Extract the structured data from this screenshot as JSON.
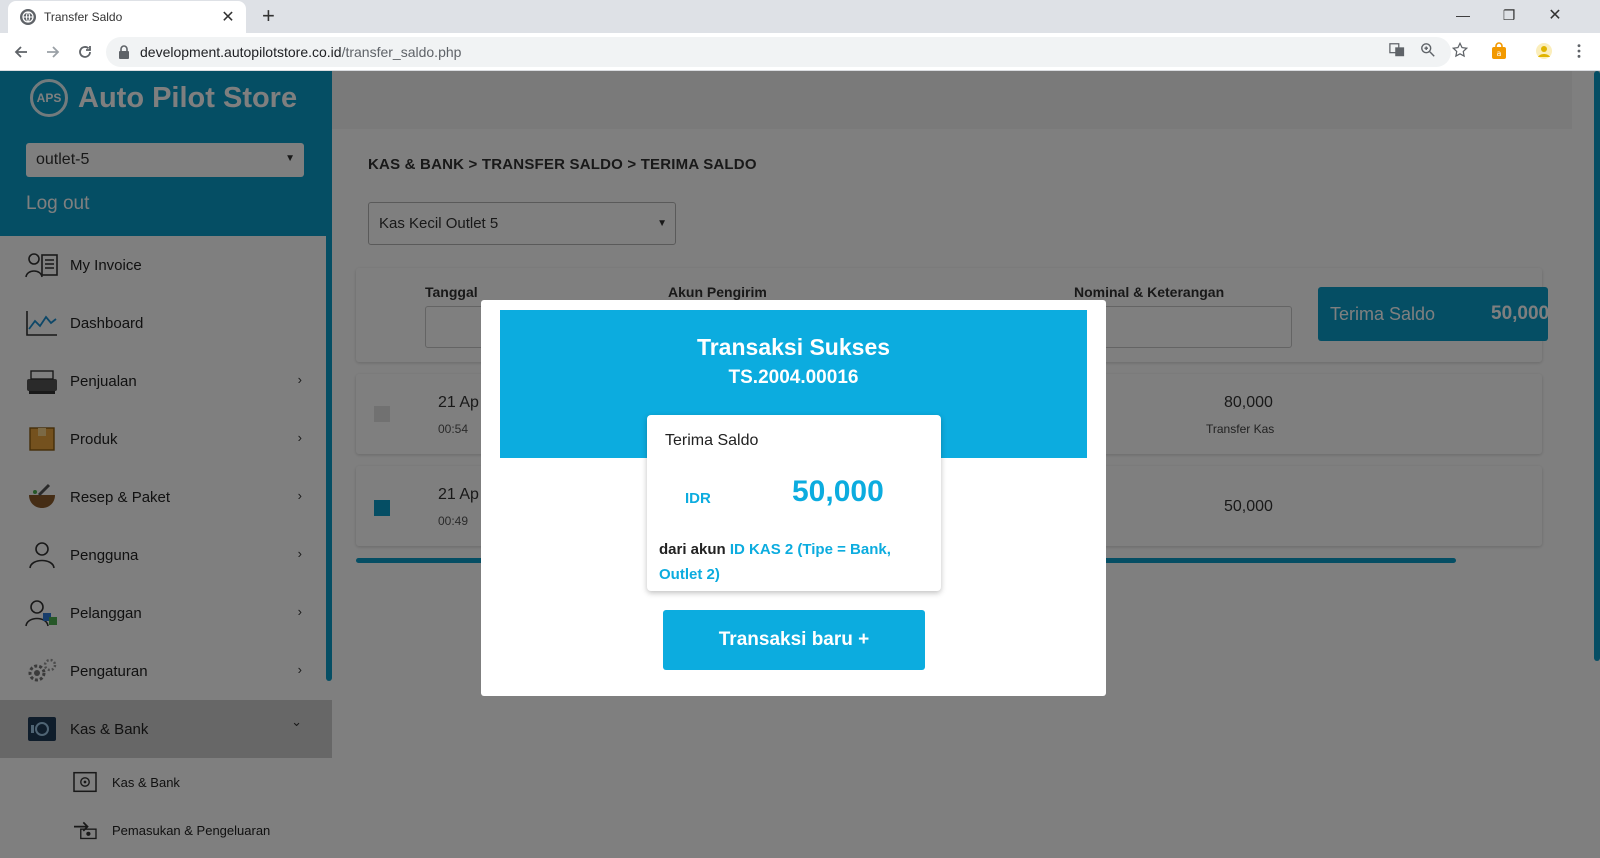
{
  "browser": {
    "tab_title": "Transfer Saldo",
    "tab_close": "✕",
    "new_tab": "+",
    "url_host": "development.autopilotstore.co.id",
    "url_path": "/transfer_saldo.php",
    "minimize": "—",
    "restore": "❐",
    "close": "✕"
  },
  "sidebar": {
    "logo_text": "APS",
    "brand": "Auto Pilot Store",
    "outlet_value": "outlet-5",
    "logout": "Log out",
    "items": [
      {
        "label": "My Invoice",
        "icon": "invoice-icon",
        "chevron": ""
      },
      {
        "label": "Dashboard",
        "icon": "dashboard-chart-icon",
        "chevron": ""
      },
      {
        "label": "Penjualan",
        "icon": "cash-register-icon",
        "chevron": "›"
      },
      {
        "label": "Produk",
        "icon": "box-icon",
        "chevron": "›"
      },
      {
        "label": "Resep & Paket",
        "icon": "mortar-icon",
        "chevron": "›"
      },
      {
        "label": "Pengguna",
        "icon": "user-icon",
        "chevron": "›"
      },
      {
        "label": "Pelanggan",
        "icon": "customer-icon",
        "chevron": "›"
      },
      {
        "label": "Pengaturan",
        "icon": "gears-icon",
        "chevron": "›"
      },
      {
        "label": "Kas & Bank",
        "icon": "safe-icon",
        "chevron": "⌄"
      }
    ],
    "subitems": [
      {
        "label": "Kas & Bank",
        "icon": "safe-small-icon"
      },
      {
        "label": "Pemasukan & Pengeluaran",
        "icon": "money-exchange-icon"
      }
    ]
  },
  "main": {
    "breadcrumb": "KAS & BANK > TRANSFER SALDO > TERIMA SALDO",
    "kas_select": "Kas Kecil Outlet 5",
    "filter": {
      "col_tanggal": "Tanggal",
      "col_akun": "Akun Pengirim",
      "col_nominal": "Nominal & Keterangan",
      "terima_label": "Terima Saldo",
      "terima_amount": "50,000"
    },
    "rows": [
      {
        "date": "21 Ap",
        "time": "00:54",
        "amount": "80,000",
        "note": "Transfer Kas",
        "checked": false
      },
      {
        "date": "21 Ap",
        "time": "00:49",
        "amount": "50,000",
        "note": "",
        "checked": true
      }
    ]
  },
  "modal": {
    "title": "Transaksi Sukses",
    "trans_id": "TS.2004.00016",
    "card_title": "Terima Saldo",
    "currency": "IDR",
    "amount": "50,000",
    "desc_prefix": "dari akun ",
    "desc_account": "ID KAS 2 (Tipe = Bank, Outlet 2)",
    "new_button": "Transaksi baru +"
  },
  "colors": {
    "primary": "#0a9dc9",
    "modal_accent": "#0cacdf",
    "overlay": "rgba(0,0,0,0.5)"
  }
}
